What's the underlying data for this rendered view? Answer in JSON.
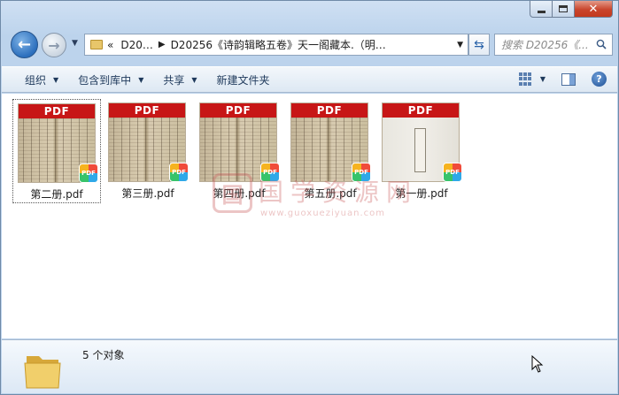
{
  "window": {
    "minimize_label": "Minimize",
    "maximize_label": "Maximize",
    "close_label": "Close"
  },
  "nav": {
    "address_overflow": "«",
    "address_parts": [
      "D20…",
      "D20256《诗韵辑略五卷》天一阁藏本.（明…"
    ],
    "search_placeholder": "搜索 D20256《..."
  },
  "toolbar": {
    "organize": "组织",
    "include_in_library": "包含到库中",
    "share": "共享",
    "new_folder": "新建文件夹"
  },
  "files": [
    {
      "name": "第二册.pdf",
      "badge": "PDF",
      "selected": true
    },
    {
      "name": "第三册.pdf",
      "badge": "PDF",
      "selected": false
    },
    {
      "name": "第四册.pdf",
      "badge": "PDF",
      "selected": false
    },
    {
      "name": "第五册.pdf",
      "badge": "PDF",
      "selected": false
    },
    {
      "name": "第一册.pdf",
      "badge": "PDF",
      "selected": false
    }
  ],
  "watermark": {
    "seal": "国",
    "text": "国学资源网",
    "url": "www.guoxueziyuan.com"
  },
  "details": {
    "status": "5 个对象"
  },
  "colors": {
    "pdf_band": "#c71616",
    "toolbar_text": "#1e395b",
    "close_button": "#c9452c"
  }
}
